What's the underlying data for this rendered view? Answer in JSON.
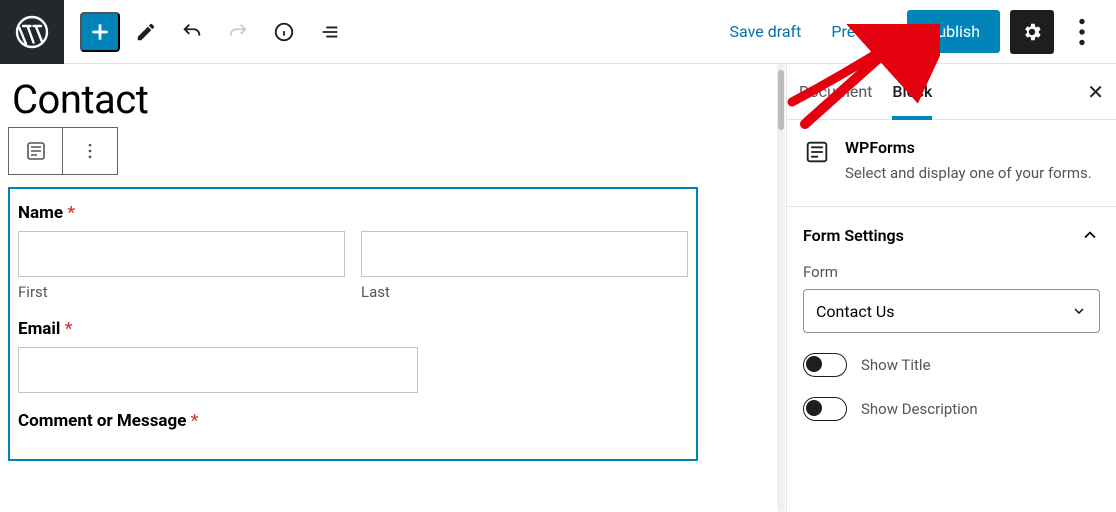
{
  "topbar": {
    "save_draft": "Save draft",
    "preview": "Preview",
    "publish": "Publish"
  },
  "page": {
    "title": "Contact"
  },
  "form": {
    "name_label": "Name",
    "first_label": "First",
    "last_label": "Last",
    "email_label": "Email",
    "comment_label": "Comment or Message",
    "required_mark": "*"
  },
  "sidebar": {
    "tabs": {
      "document": "Document",
      "block": "Block"
    },
    "block_info": {
      "name": "WPForms",
      "description": "Select and display one of your forms."
    },
    "panel": {
      "title": "Form Settings",
      "form_label": "Form",
      "selected_form": "Contact Us",
      "show_title": "Show Title",
      "show_description": "Show Description"
    }
  }
}
